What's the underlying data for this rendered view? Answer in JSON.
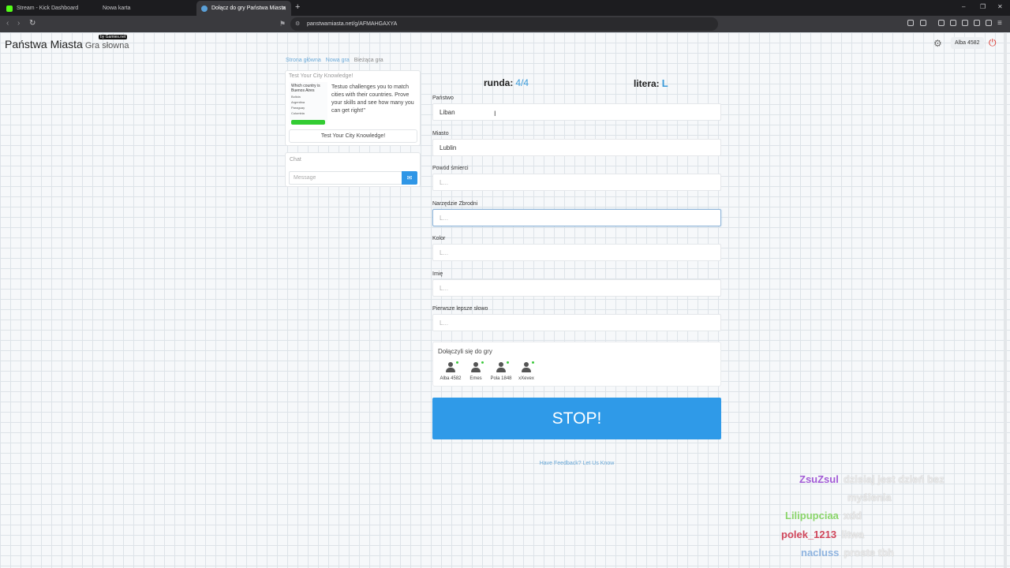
{
  "browser": {
    "tabs": [
      {
        "title": "Stream - Kick Dashboard",
        "color": "#53fc18"
      },
      {
        "title": "Nowa karta",
        "color": "#1c1c1f"
      },
      {
        "title": "Dołącz do gry Państwa Miasta",
        "color": "#5aa0d8"
      }
    ],
    "url": "panstwamiasta.net/g/AFMAHGAXYA"
  },
  "header": {
    "brand": "Państwa Miasta",
    "brand_sub": "Gra słowna",
    "badge": "by Gamies.net",
    "user": "Alba 4582"
  },
  "breadcrumbs": [
    "Strona główna",
    "Nowa gra",
    "Bieżąca gra"
  ],
  "ad": {
    "title": "Test Your City Knowledge!",
    "img_question": "Which country is Buenos Aires",
    "img_options": [
      "Bolivia",
      "Argentina",
      "Paraguay",
      "Colombia"
    ],
    "text": "Testuo challenges you to match cities with their countries. Prove your skills and see how many you can get right!\"",
    "button": "Test Your City Knowledge!"
  },
  "chat": {
    "title": "Chat",
    "placeholder": "Message"
  },
  "game": {
    "round_label": "runda:",
    "round_value": "4/4",
    "letter_label": "litera:",
    "letter_value": "L"
  },
  "fields": [
    {
      "label": "Państwo",
      "value": "Liban"
    },
    {
      "label": "Miasto",
      "value": "Lublin"
    },
    {
      "label": "Powód śmierci",
      "value": "L..."
    },
    {
      "label": "Narzędzie Zbrodni",
      "value": "L..."
    },
    {
      "label": "Kolor",
      "value": "L..."
    },
    {
      "label": "Imię",
      "value": "L..."
    },
    {
      "label": "Pierwsze lepsze słowo",
      "value": "L..."
    }
  ],
  "players": {
    "title": "Dołączyli się do gry",
    "list": [
      "Alba 4582",
      "Emes",
      "Pola 1848",
      "xXevex"
    ]
  },
  "stop_label": "STOP!",
  "feedback": "Have Feedback? Let Us Know",
  "stream_chat": [
    {
      "user": "ZsuZsul",
      "text": "dzisiaj jest dzień bez",
      "text2": "myślenia",
      "color": "#a35bd6"
    },
    {
      "user": "Lilipupciaa",
      "text": "xdd",
      "color": "#8bd66b"
    },
    {
      "user": "polek_1213",
      "text": "litwa",
      "color": "#d0455a"
    },
    {
      "user": "nacluss",
      "text": "proste tbh",
      "color": "#8fb4e0"
    }
  ]
}
